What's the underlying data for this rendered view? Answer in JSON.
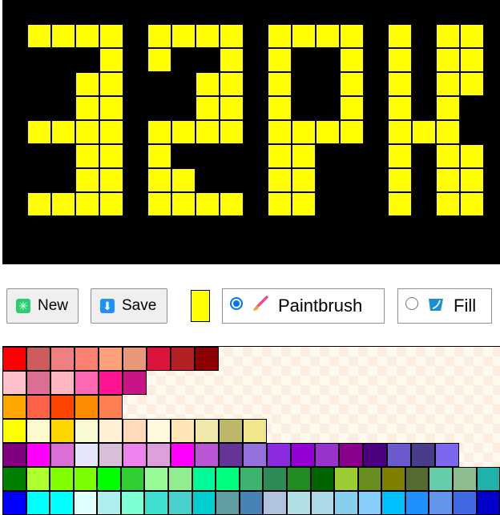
{
  "canvas": {
    "background": "#000000",
    "pixel_color": "#ffff00",
    "columns": 20,
    "rows": 11,
    "pixels": [
      "....................",
      ".oooo.oooo.oooo.o.oo",
      "....o.o..o.o..o.o.oo",
      "...oo...oo.o..o.o.oo",
      "...oo...oo.o..o.o.o.",
      ".oooo.oooo.oooo.ooo.",
      "...oo.o....oo...o.oo",
      "...oo.oo...oo...o.oo",
      ".oooo.oooo.oo...o.oo",
      "....................",
      "...................."
    ]
  },
  "toolbar": {
    "new_label": "New",
    "new_icon": "asterisk-icon",
    "new_icon_color": "#2ecc71",
    "save_label": "Save",
    "save_icon": "download-arrow-icon",
    "save_icon_color": "#1e90ff",
    "current_color": "#ffff00",
    "tools": [
      {
        "label": "Paintbrush",
        "icon": "paintbrush-icon",
        "selected": true
      },
      {
        "label": "Fill",
        "icon": "paint-bucket-icon",
        "selected": false
      }
    ]
  },
  "palette": {
    "rows": [
      [
        "#ff0000",
        "#cd5c5c",
        "#f08080",
        "#fa8072",
        "#ffa07a",
        "#e9967a",
        "#dc143c",
        "#b22222",
        "#8b0000"
      ],
      [
        "#ffc0cb",
        "#db7093",
        "#ffb6c1",
        "#ff69b4",
        "#ff1493",
        "#c71585"
      ],
      [
        "#ffa500",
        "#ff6347",
        "#ff4500",
        "#ff8c00",
        "#ff7f50"
      ],
      [
        "#ffff00",
        "#fffacd",
        "#ffd700",
        "#fafad2",
        "#ffefd5",
        "#ffdab9",
        "#fff8dc",
        "#ffe4b5",
        "#eee8aa",
        "#bdb76b",
        "#f0e68c"
      ],
      [
        "#800080",
        "#ff00ff",
        "#da70d6",
        "#e6e6fa",
        "#d8bfd8",
        "#ee82ee",
        "#dda0dd",
        "#ff00ff",
        "#ba55d3",
        "#663399",
        "#9370db",
        "#8a2be2",
        "#9400d3",
        "#9932cc",
        "#8b008b",
        "#4b0082",
        "#6a5acd",
        "#483d8b",
        "#7b68ee"
      ],
      [
        "#008000",
        "#adff2f",
        "#7fff00",
        "#7cfc00",
        "#00ff00",
        "#32cd32",
        "#98fb98",
        "#90ee90",
        "#00fa9a",
        "#00ff7f",
        "#3cb371",
        "#2e8b57",
        "#228b22",
        "#006400",
        "#9acd32",
        "#6b8e23",
        "#808000",
        "#556b2f",
        "#66cdaa",
        "#8fbc8f",
        "#20b2aa"
      ],
      [
        "#0000ff",
        "#00ffff",
        "#00ffff",
        "#e0ffff",
        "#afeeee",
        "#7fffd4",
        "#40e0d0",
        "#48d1cc",
        "#00ced1",
        "#5f9ea0",
        "#4682b4",
        "#b0c4de",
        "#b0e0e6",
        "#add8e6",
        "#87ceeb",
        "#87cefa",
        "#00bfff",
        "#1e90ff",
        "#6495ed",
        "#4169e1",
        "#0000cd"
      ]
    ]
  }
}
